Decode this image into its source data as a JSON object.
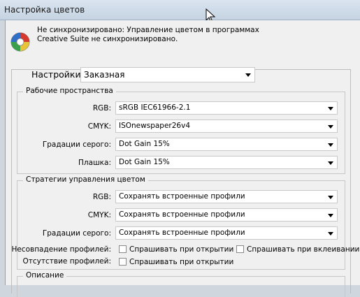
{
  "window": {
    "title": "Настройка цветов"
  },
  "sync": {
    "icon": "color-wheel-icon",
    "line1": "Не синхронизировано: Управление цветом в программах",
    "line2": "Creative Suite не синхронизировано."
  },
  "settings": {
    "label": "Настройки:",
    "value": "Заказная"
  },
  "workspaces": {
    "title": "Рабочие пространства",
    "rgb_label": "RGB:",
    "rgb_value": "sRGB IEC61966-2.1",
    "cmyk_label": "CMYK:",
    "cmyk_value": "ISOnewspaper26v4",
    "gray_label": "Градации серого:",
    "gray_value": "Dot Gain 15%",
    "spot_label": "Плашка:",
    "spot_value": "Dot Gain 15%"
  },
  "policies": {
    "title": "Стратегии управления цветом",
    "rgb_label": "RGB:",
    "rgb_value": "Сохранять встроенные профили",
    "cmyk_label": "CMYK:",
    "cmyk_value": "Сохранять встроенные профили",
    "gray_label": "Градации серого:",
    "gray_value": "Сохранять встроенные профили",
    "mismatch_label": "Несовпадение профилей:",
    "ask_open": "Спрашивать при открытии",
    "ask_open_checked": false,
    "ask_paste": "Спрашивать при вклеивании",
    "ask_paste_checked": false,
    "missing_label": "Отсутствие профилей:",
    "missing_ask_open": "Спрашивать при открытии",
    "missing_ask_open_checked": false
  },
  "description": {
    "title": "Описание"
  }
}
